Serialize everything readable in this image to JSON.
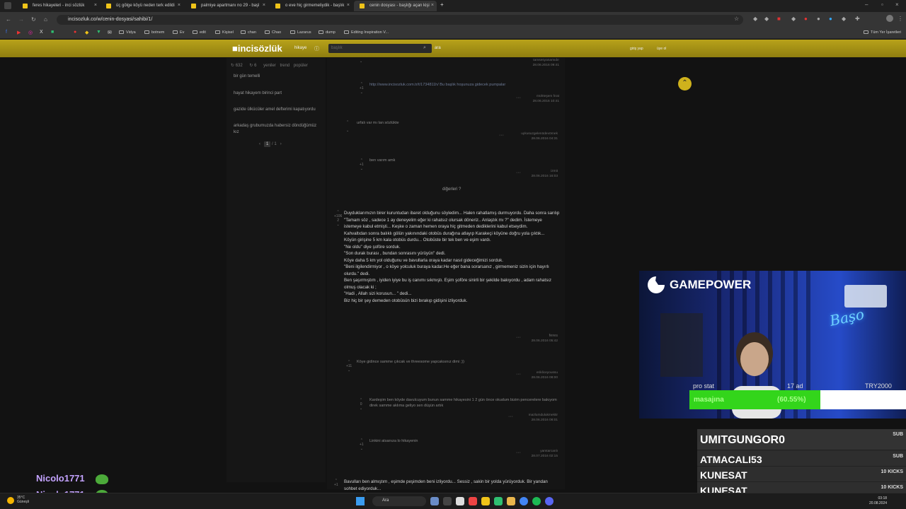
{
  "browser": {
    "tabs": [
      {
        "label": "feres hikayeleri - inci sözlük"
      },
      {
        "label": "üç gölge köyü neden terk edildi"
      },
      {
        "label": "palmiye apartmanı no 29 - başl"
      },
      {
        "label": "o eve hiç girmemeliydik - başlık"
      },
      {
        "label": "cenin dosyası - başlığı açan kişi"
      }
    ],
    "url": "incisozluk.co/w/cenin-dosyasi/sahibi/1/",
    "bookmarks": [
      "Vidya",
      "botnem",
      "Ev",
      "edit",
      "Kişisel",
      "chan",
      "Chao",
      "Lazarus",
      "dump",
      "Editing Inspiration V..."
    ],
    "bookmarks_right": "Tüm Yer İşaretleri",
    "colors": {
      "accent": "#cfb21c",
      "tab_favicon": "#f0c419"
    }
  },
  "site": {
    "logo": "incisözlük",
    "nav_link": "hikaye",
    "search_placeholder": "başlık",
    "search_button": "ara",
    "login": "giriş yap",
    "register": "üye ol"
  },
  "sidebar": {
    "stats": [
      "632",
      "6"
    ],
    "tabs": [
      "yeniler",
      "trend",
      "popüler"
    ],
    "items": [
      "bir gün temelli",
      "hayat hikayem birinci part",
      "gazide ülkücüler amel defterimi kapatıyordu",
      "arkadaş grubumuzda habersiz döndüğümüz kız"
    ],
    "pager": {
      "current": "1",
      "total": "/ 1",
      "prev": "‹",
      "next": "›"
    }
  },
  "thread": {
    "replies": [
      {
        "text": "http://www.incisozluk.com.tr/t/1734811h/ Bu başlık hoşunuza gidecek pumpalar",
        "author": "mühteşem fırat",
        "date": "28.06.2016 10:41"
      },
      {
        "text": "urfalı var mı lan sözlükte",
        "author": "uykusuzgelenödevörnek",
        "date": "28.06.2016 04:31"
      },
      {
        "text": "ben varım amk",
        "author": "izmit",
        "date": "28.06.2016 16:03"
      }
    ],
    "top_meta": {
      "author": "tamsesyanamıdır",
      "date": "28.06.2016 09:41"
    },
    "more_link": "diğerleri ?",
    "entry_votes": {
      "up": "+106",
      "score": "2"
    },
    "entry": [
      "Duyduklarımızın birer kuruntudan ibaret olduğunu söyledim... Halen rahatlamış durmuyordu. Daha sonra sarılıp",
      "\"Tamam söz , sadece 1 ay deneyelim eğer ki rahatsız olursak döneriz.. Anlaştık mı ?\" dedim. İstemeye istemeye kabul etmişti... Keşke o zaman hemen oraya hiç gitmeden dediklerini kabul etseydim.",
      "Kahvaltıdan sonra balıklı gölün yakınındaki otobüs durağına atlayıp Karakeçi köyüne doğru yola çıktık...",
      "Köyün girişine 5 km kala otobüs durdu... Otobüste bir tek ben ve eşim vardı.",
      "\"Ne oldu\" diye şoföre sorduk.",
      "\"Son durak burası , bundan sonrasını yürüyün\" dedi.",
      "Köye daha 5 km yol olduğunu ve bavullarla oraya kadar nasıl gideceğimizi sorduk.",
      "\"Beni ilgilendirmiyor , o köye yolculuk buraya kadar.He eğer bana sorarsanız , girmemeniz sizin için hayırlı olurdu.\" dedi.",
      "Ben şaşırmıştım , iyiden iyiye bu iş canımı sıkmıştı. Eşim şoföre sinirli bir şekilde bakıyordu , adam rahatsız olmuş olacak ki ;",
      "\"Hadi , Allah sizi korusun... \" dedi...",
      "Biz hiç bir şey demeden otobüsün bizi bırakıp gidişini izliyorduk."
    ],
    "entry_author": "feres",
    "entry_date": "28.06.2016 05:42",
    "sub_replies": [
      {
        "text": "Köye gidince samme çıkcak ve threesome yapcaksınız dimi ;))",
        "author": "erikliceyoussu",
        "date": "28.06.2016 08:00",
        "votes": "+11"
      },
      {
        "text": "Kardeşim ben köyde davulcuyum bunun samme hikayesini 1 2 gün önce okudum bizim pencerelere bakıyom direk samme aklıma geliyo sen düşün artık",
        "author": "mazlumdulukmektir",
        "date": "28.06.2016 08:01",
        "votes": ""
      },
      {
        "text": "Linkini atsanıza lo hikayenin",
        "author": "yamtarcanlı",
        "date": "28.07.2016 02:15",
        "votes": "+1"
      }
    ],
    "bottom_text": "Bavulları ben almıştım , eşimde peşimden beni izliyordu... Sessiz , sakin bir yolda yürüyorduk. Bir yandan sohbet ediyorduk..."
  },
  "overlay": {
    "brand": "GAMEPOWER",
    "neon_sign": "Başo",
    "progress_label": "masajına",
    "progress_value": 0.6055,
    "progress_pct_text": "(60.55%)",
    "progress_top_left": "pro stat",
    "progress_top_mid": "17 ad",
    "progress_goal": "TRY2000",
    "progress_color": "#33d51b",
    "subs": [
      {
        "name": "UMITGUNGOR0",
        "type": "SUB"
      },
      {
        "name": "ATMACALI53",
        "type": "SUB"
      },
      {
        "name": "KUNESAT",
        "type": "10 KICKS"
      },
      {
        "name": "KUNESAT",
        "type": "10 KICKS"
      }
    ],
    "chat": [
      "Nicolo1771",
      "Nicolo1771"
    ]
  },
  "taskbar": {
    "weather_temp": "35°C",
    "weather_desc": "Güneşli",
    "search": "Ara",
    "time": "03:18",
    "date": "20.08.2024"
  }
}
